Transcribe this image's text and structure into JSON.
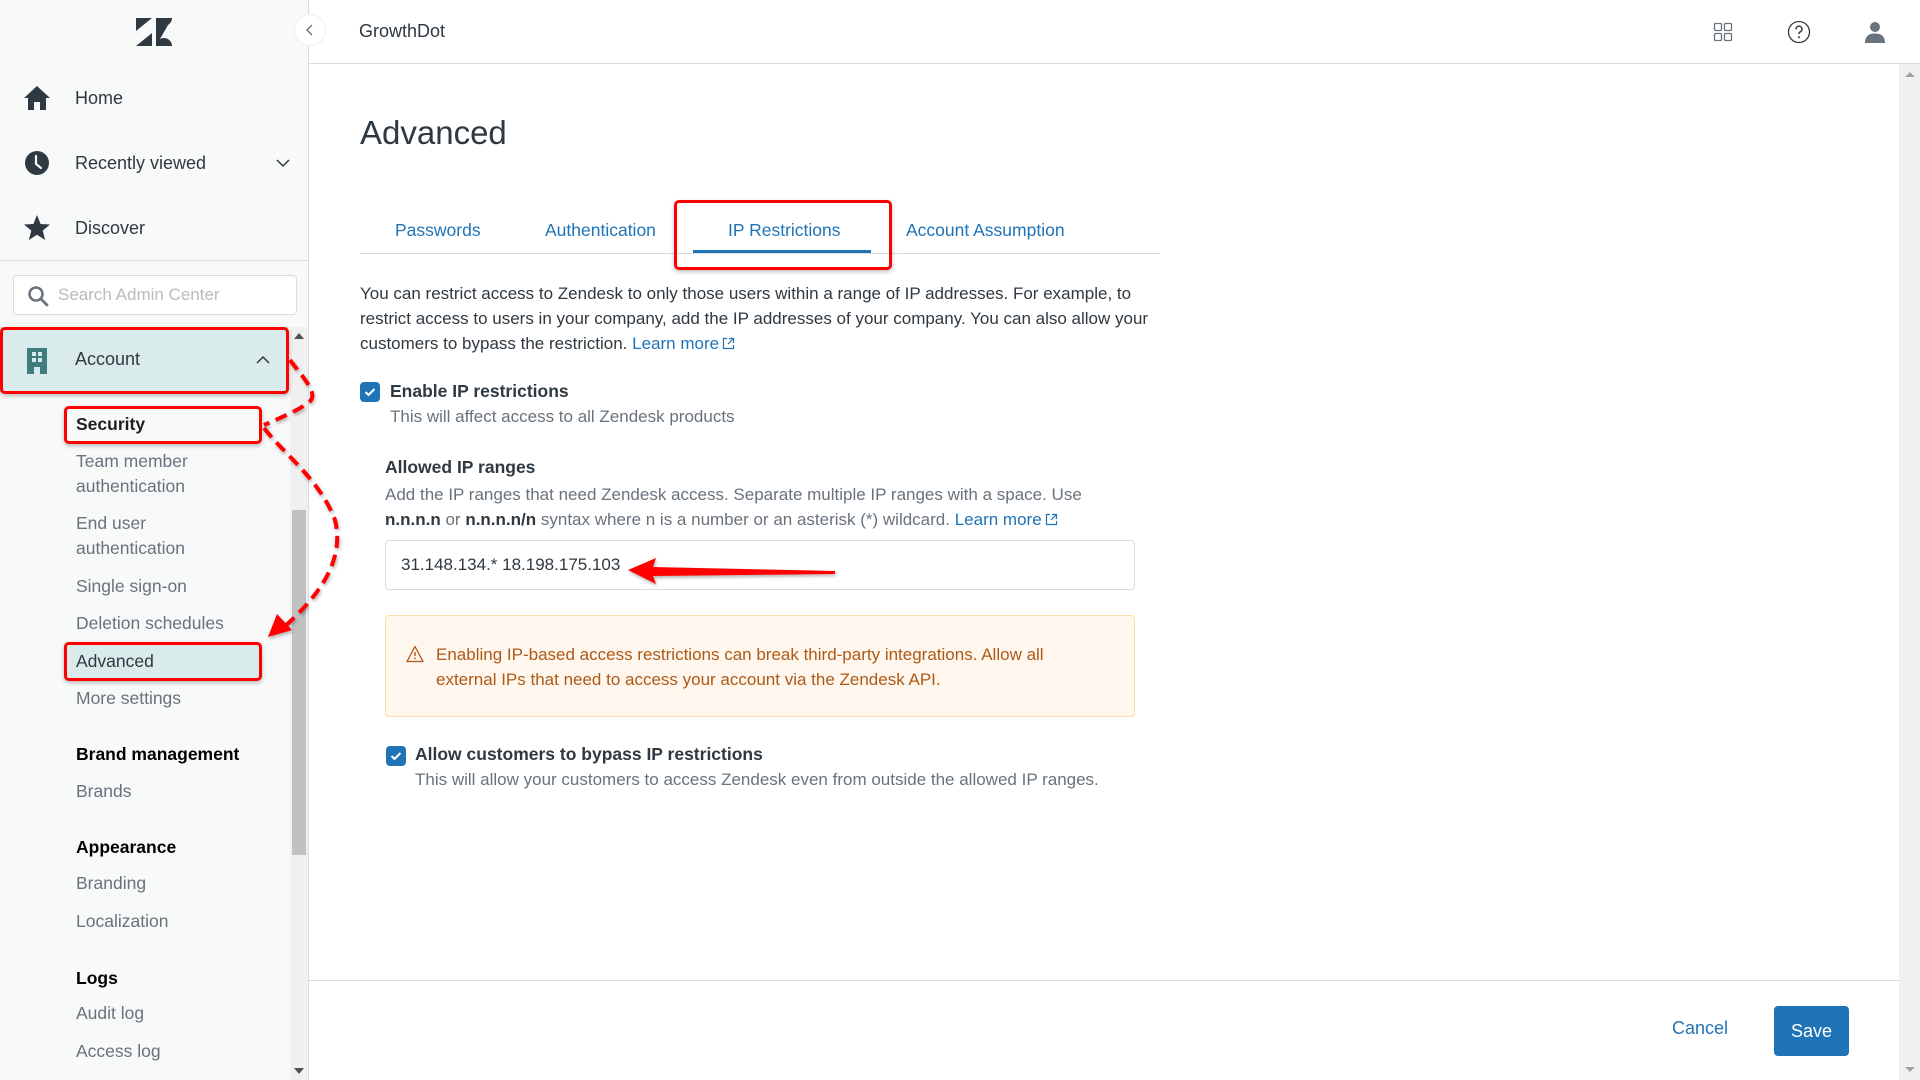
{
  "app": {
    "account_name": "GrowthDot"
  },
  "header": {
    "icons": [
      "product-tray-icon",
      "help-icon",
      "user-profile-icon"
    ]
  },
  "sidebar": {
    "logo": "zendesk-logo",
    "nav": [
      {
        "label": "Home",
        "icon": "home-icon"
      },
      {
        "label": "Recently viewed",
        "icon": "clock-icon",
        "chevron": "chevron-down-icon"
      },
      {
        "label": "Discover",
        "icon": "star-icon"
      }
    ],
    "search": {
      "placeholder": "Search Admin Center",
      "value": ""
    },
    "section": {
      "label": "Account",
      "icon": "building-icon",
      "expanded": true
    },
    "groups": [
      {
        "title": "Security",
        "items": [
          "Team member authentication",
          "End user authentication",
          "Single sign-on",
          "Deletion schedules",
          "Advanced",
          "More settings"
        ],
        "item_lines": [
          [
            "Team member",
            "authentication"
          ],
          [
            "End user",
            "authentication"
          ]
        ],
        "active": "Advanced"
      },
      {
        "title": "Brand management",
        "items": [
          "Brands"
        ]
      },
      {
        "title": "Appearance",
        "items": [
          "Branding",
          "Localization"
        ]
      },
      {
        "title": "Logs",
        "items": [
          "Audit log",
          "Access log"
        ]
      }
    ]
  },
  "main": {
    "title": "Advanced",
    "tabs": [
      {
        "label": "Passwords",
        "active": false
      },
      {
        "label": "Authentication",
        "active": false
      },
      {
        "label": "IP Restrictions",
        "active": true
      },
      {
        "label": "Account Assumption",
        "active": false
      }
    ],
    "intro": "You can restrict access to Zendesk to only those users within a range of IP addresses. For example, to restrict access to users in your company, add the IP addresses of your company. You can also allow your customers to bypass the restriction.",
    "learn_more": "Learn more",
    "enable_ip": {
      "checked": true,
      "label": "Enable IP restrictions",
      "description": "This will affect access to all Zendesk products"
    },
    "allowed_ranges": {
      "label": "Allowed IP ranges",
      "desc_part1": "Add the IP ranges that need Zendesk access. Separate multiple IP ranges with a space. Use",
      "syntax1": "n.n.n.n",
      "or": "or",
      "syntax2": "n.n.n.n/n",
      "desc_part2": "syntax where n is a number or an asterisk (*) wildcard.",
      "learn_more": "Learn more",
      "value": "31.148.134.* 18.198.175.103"
    },
    "warning": {
      "icon": "alert-triangle-icon",
      "text": "Enabling IP-based access restrictions can break third-party integrations. Allow all external IPs that need to access your account via the Zendesk API."
    },
    "bypass": {
      "checked": true,
      "label": "Allow customers to bypass IP restrictions",
      "description": "This will allow your customers to access Zendesk even from outside the allowed IP ranges."
    }
  },
  "footer": {
    "cancel_label": "Cancel",
    "save_label": "Save"
  },
  "colors": {
    "accent": "#1f73b7",
    "active_nav_bg": "#d9ebeb",
    "warning_bg": "#fff7ed",
    "warning_text": "#ad5918",
    "annotation": "#ff0000"
  }
}
